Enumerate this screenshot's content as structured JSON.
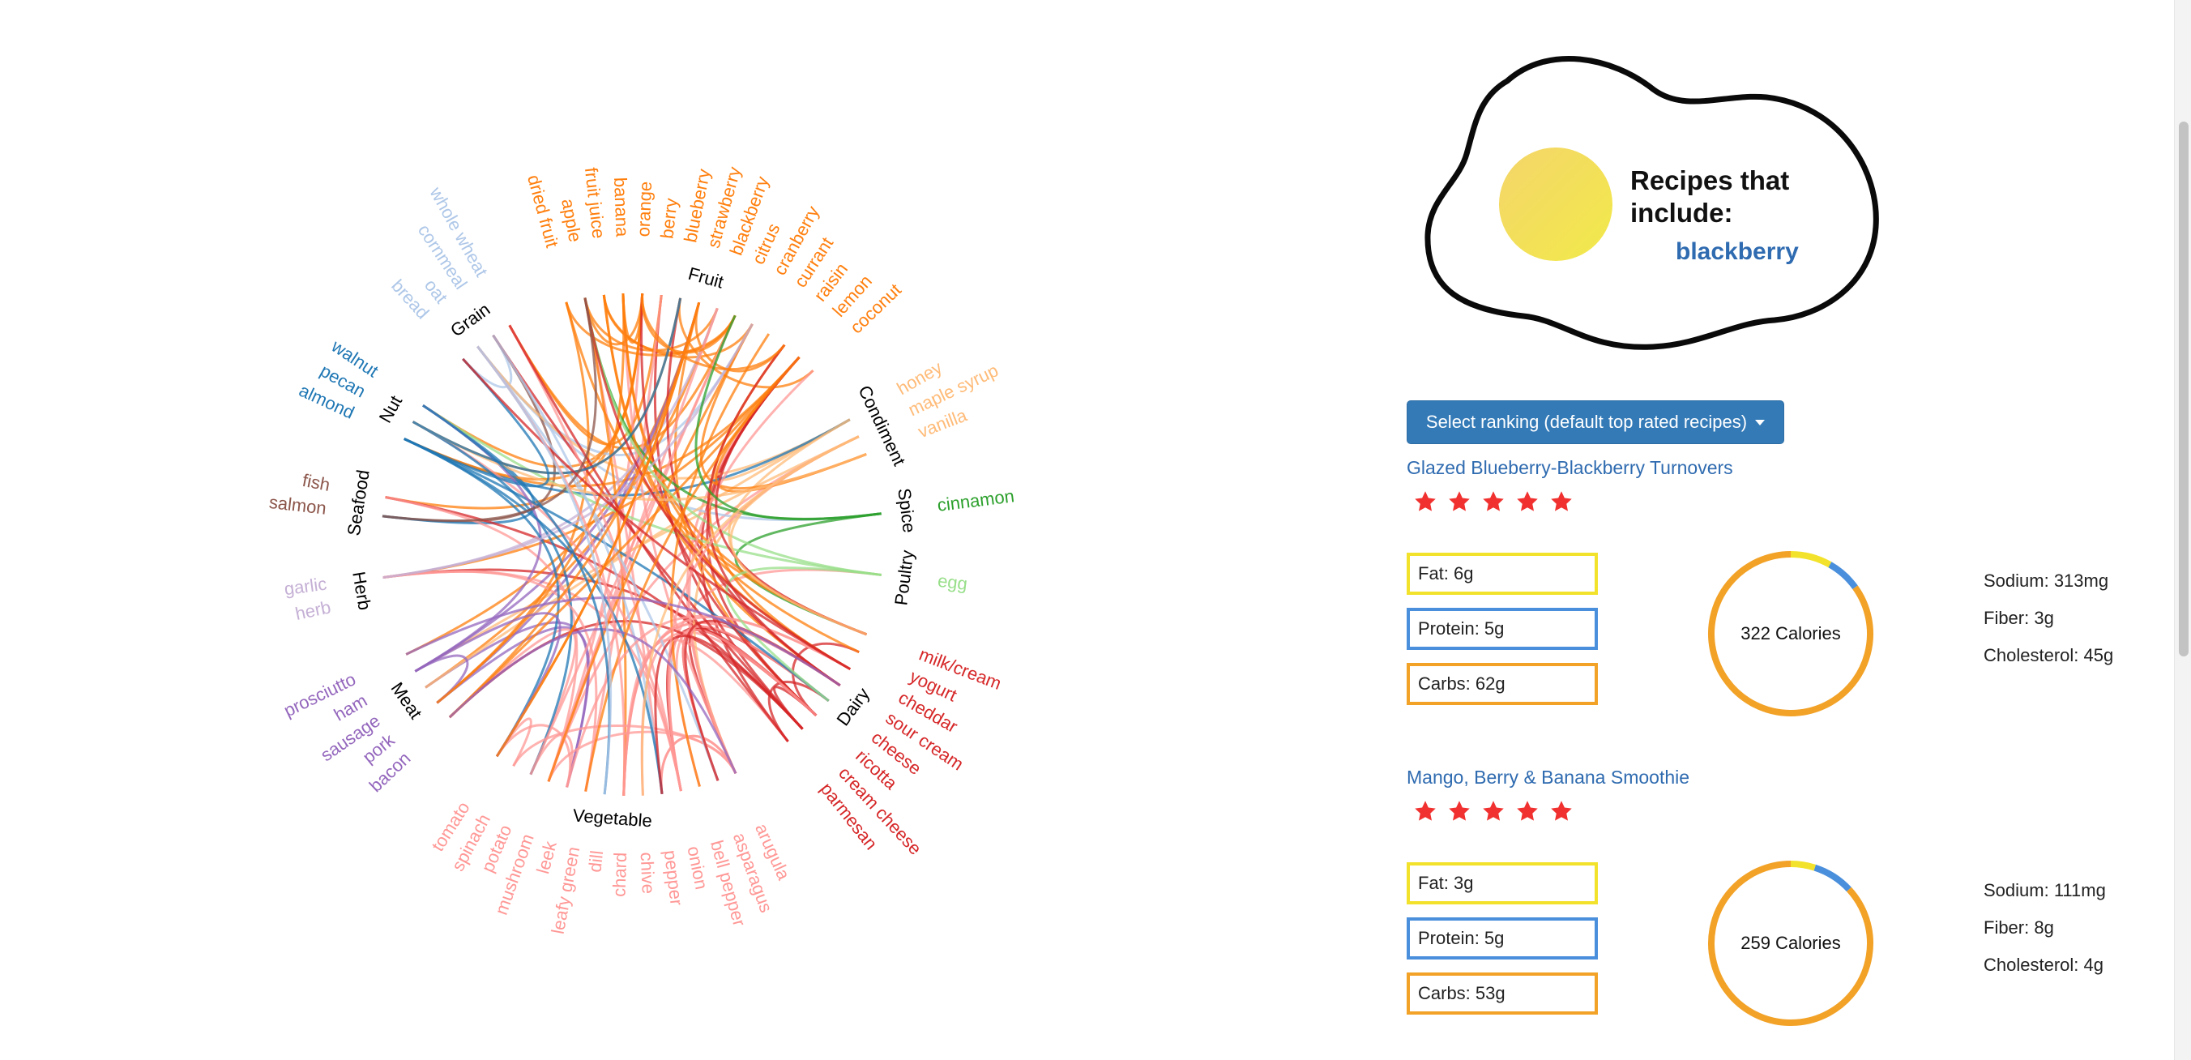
{
  "header": {
    "title": "Recipes that include:",
    "ingredient": "blackberry"
  },
  "ranking": {
    "button_label": "Select ranking (default top rated recipes)"
  },
  "recipes": [
    {
      "title": "Glazed Blueberry-Blackberry Turnovers",
      "rating": 5,
      "fat": "Fat: 6g",
      "protein": "Protein: 5g",
      "carbs": "Carbs: 62g",
      "calories": "322 Calories",
      "sodium": "Sodium: 313mg",
      "fiber": "Fiber: 3g",
      "cholesterol": "Cholesterol: 45g",
      "macros": {
        "fat": 6,
        "protein": 5,
        "carbs": 62
      }
    },
    {
      "title": "Mango, Berry & Banana Smoothie",
      "rating": 5,
      "fat": "Fat: 3g",
      "protein": "Protein: 5g",
      "carbs": "Carbs: 53g",
      "calories": "259 Calories",
      "sodium": "Sodium: 111mg",
      "fiber": "Fiber: 8g",
      "cholesterol": "Cholesterol: 4g",
      "macros": {
        "fat": 3,
        "protein": 5,
        "carbs": 53
      }
    }
  ],
  "colors": {
    "fat": "#f3e22b",
    "protein": "#4a8fdc",
    "carbs": "#f2a227",
    "star": "#f0312f",
    "link": "#2f6bb0",
    "button": "#337ab7",
    "yolk_a": "#f4d56a",
    "yolk_b": "#f2ea4a"
  },
  "chord": {
    "groups": [
      {
        "name": "Fruit",
        "color": "#ff7f0e",
        "items": [
          "dried fruit",
          "apple",
          "fruit juice",
          "banana",
          "orange",
          "berry",
          "blueberry",
          "strawberry",
          "blackberry",
          "citrus",
          "cranberry",
          "currant",
          "raisin",
          "lemon",
          "coconut"
        ]
      },
      {
        "name": "Condiment",
        "color": "#ffbb78",
        "items": [
          "honey",
          "maple syrup",
          "vanilla"
        ]
      },
      {
        "name": "Spice",
        "color": "#2ca02c",
        "items": [
          "cinnamon"
        ]
      },
      {
        "name": "Poultry",
        "color": "#98df8a",
        "items": [
          "egg"
        ]
      },
      {
        "name": "Dairy",
        "color": "#d62728",
        "items": [
          "milk/cream",
          "yogurt",
          "cheddar",
          "sour cream",
          "cheese",
          "ricotta",
          "cream cheese",
          "parmesan"
        ]
      },
      {
        "name": "Vegetable",
        "color": "#ff9896",
        "items": [
          "arugula",
          "asparagus",
          "bell pepper",
          "onion",
          "pepper",
          "chive",
          "chard",
          "dill",
          "leafy green",
          "leek",
          "mushroom",
          "potato",
          "spinach",
          "tomato"
        ]
      },
      {
        "name": "Meat",
        "color": "#9467bd",
        "items": [
          "bacon",
          "pork",
          "sausage",
          "ham",
          "prosciutto"
        ]
      },
      {
        "name": "Herb",
        "color": "#c5b0d5",
        "items": [
          "herb",
          "garlic"
        ]
      },
      {
        "name": "Seafood",
        "color": "#8c564b",
        "items": [
          "salmon",
          "fish"
        ]
      },
      {
        "name": "Nut",
        "color": "#1f77b4",
        "items": [
          "almond",
          "pecan",
          "walnut"
        ]
      },
      {
        "name": "Grain",
        "color": "#aec7e8",
        "items": [
          "bread",
          "oat",
          "cornmeal",
          "whole wheat"
        ]
      }
    ]
  }
}
